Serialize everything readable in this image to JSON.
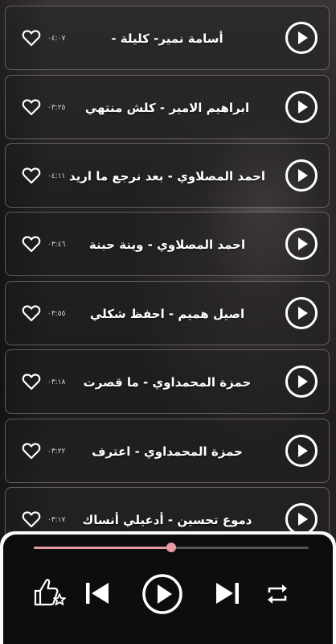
{
  "tracks": [
    {
      "title": "أسامة نمير- كليلة -",
      "duration": "٠٤:٠٧"
    },
    {
      "title": "ابراهيم الامير - كلش منتهي",
      "duration": "٠٣:٢٥"
    },
    {
      "title": "احمد المصلاوي - بعد نرجع ما اريد",
      "duration": "٠٤:١١"
    },
    {
      "title": "احمد المصلاوي - وينة حبنة",
      "duration": "٠٣:٤٦"
    },
    {
      "title": "اصيل هميم - احفظ شكلي",
      "duration": "٠٣:٥٥"
    },
    {
      "title": "حمزة المحمداوي - ما قصرت",
      "duration": "٠٣:١٨"
    },
    {
      "title": "حمزة المحمداوي - اعترف",
      "duration": "٠٣:٢٢"
    },
    {
      "title": "دموع تحسين - أدعيلي أنساك",
      "duration": "٠٣:١٧"
    }
  ],
  "icons": {
    "play": "play-icon",
    "favorite": "heart-outline-icon",
    "rate": "thumbs-up-star-icon",
    "previous": "skip-previous-icon",
    "next": "skip-next-icon",
    "repeat": "repeat-icon"
  },
  "player": {
    "progress": 0.5,
    "accent_color": "#e89aa5"
  }
}
